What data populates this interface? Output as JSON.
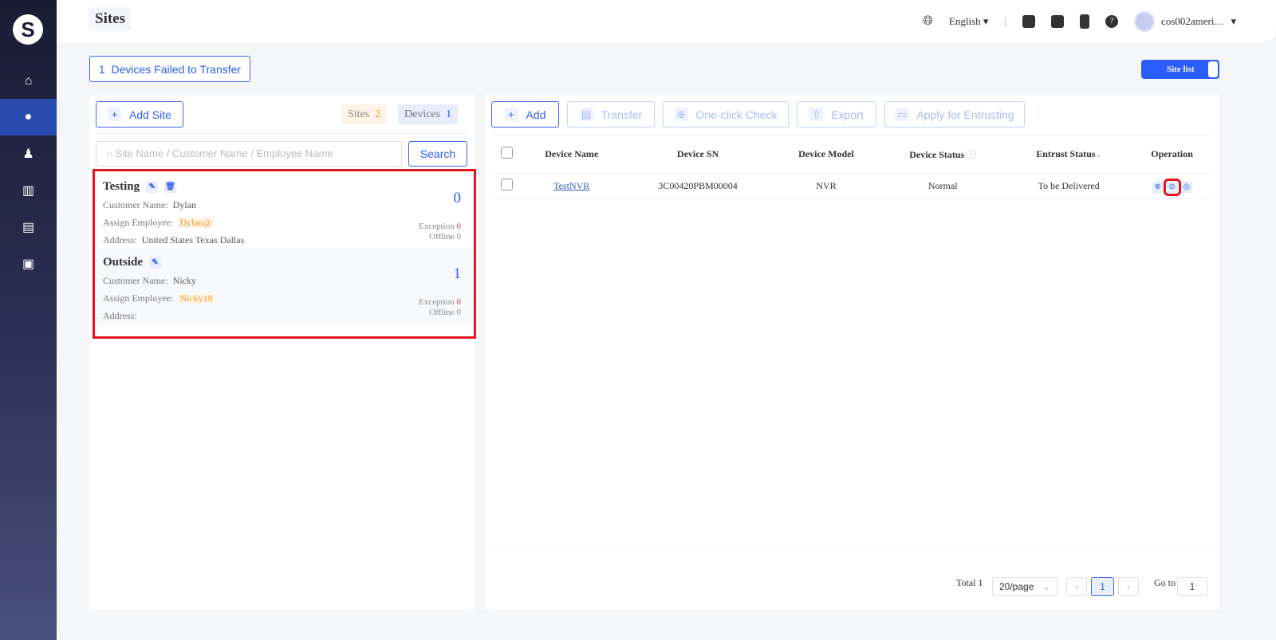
{
  "header": {
    "title": "Sites",
    "language": "English",
    "separator": "|",
    "username": "cos002ameri…"
  },
  "sidebar": {
    "logo": "S",
    "items": [
      {
        "icon": "home-icon",
        "glyph": "⌂"
      },
      {
        "icon": "location-icon",
        "glyph": "●",
        "active": true
      },
      {
        "icon": "user-icon",
        "glyph": "♟"
      },
      {
        "icon": "building-icon",
        "glyph": "▥"
      },
      {
        "icon": "document-icon",
        "glyph": "▤"
      },
      {
        "icon": "lock-icon",
        "glyph": "▣"
      }
    ]
  },
  "failed_transfer": {
    "count": "1",
    "label": "Devices Failed to Transfer"
  },
  "view_switch": {
    "label": "Site list"
  },
  "sites_panel": {
    "add_site": "Add Site",
    "sites_label": "Sites",
    "sites_count": "2",
    "devices_label": "Devices",
    "devices_count": "1",
    "search_placeholder": "Site Name / Customer Name / Employee Name",
    "search_button": "Search",
    "sites": [
      {
        "name": "Testing",
        "customer_label": "Customer Name:",
        "customer": "Dylan",
        "employee_label": "Assign Employee:",
        "employee": "Dylan@",
        "address_label": "Address:",
        "address": "United States Texas Dallas",
        "count": "0",
        "exception_label": "Exception",
        "exception": "0",
        "offline_label": "Offline",
        "offline": "0"
      },
      {
        "name": "Outside",
        "customer_label": "Customer Name:",
        "customer": "Nicky",
        "employee_label": "Assign Employee:",
        "employee": "Nicky18",
        "address_label": "Address:",
        "address": "",
        "count": "1",
        "exception_label": "Exception",
        "exception": "0",
        "offline_label": "Offline",
        "offline": "0"
      }
    ]
  },
  "toolbar": {
    "add": "Add",
    "transfer": "Transfer",
    "check": "One-click Check",
    "export": "Export",
    "entrust": "Apply for Entrusting"
  },
  "table": {
    "columns": [
      "Device Name",
      "Device SN",
      "Device Model",
      "Device Status",
      "Entrust Status",
      "Operation"
    ],
    "rows": [
      {
        "name": "TestNVR",
        "sn": "3C00420PBM00004",
        "model": "NVR",
        "status": "Normal",
        "entrust": "To be Delivered"
      }
    ]
  },
  "pagination": {
    "total": "Total 1",
    "page_size": "20/page",
    "current": "1",
    "goto_label": "Go to",
    "goto_value": "1"
  },
  "colors": {
    "accent": "#2b5ef0",
    "highlight": "#e5141e",
    "employee": "#f39a2b"
  }
}
